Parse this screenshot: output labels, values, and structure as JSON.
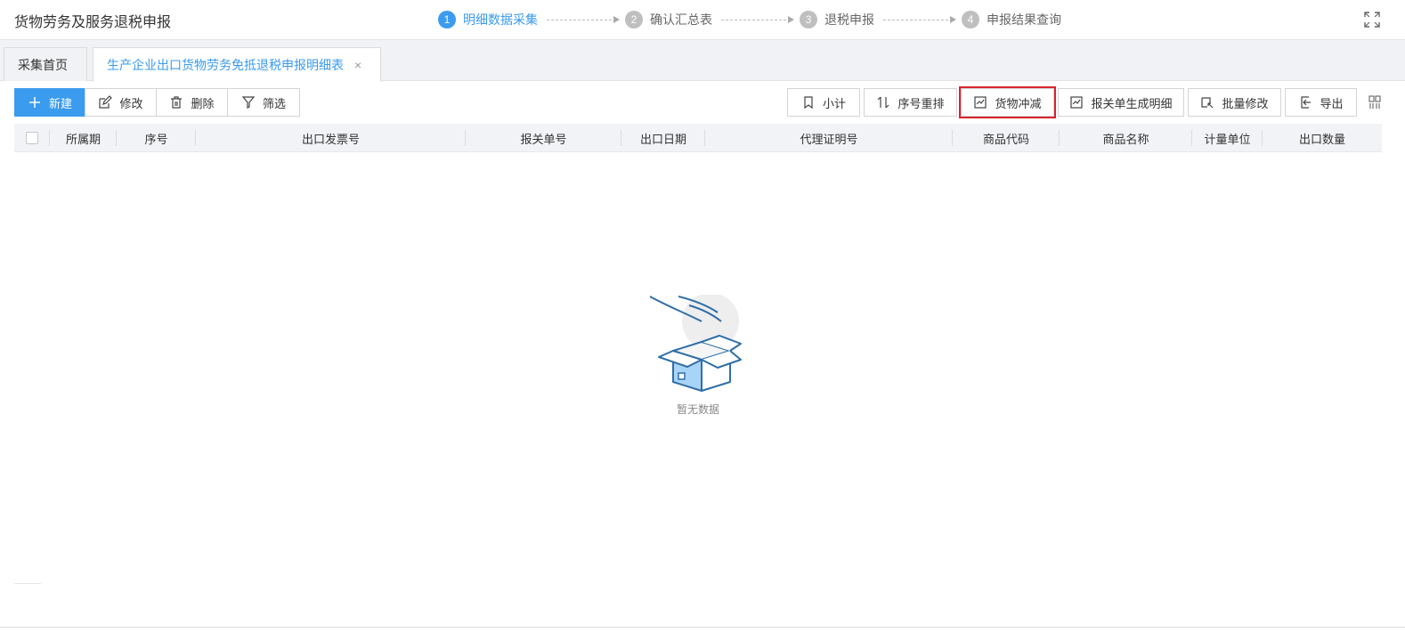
{
  "header": {
    "title": "货物劳务及服务退税申报",
    "steps": [
      {
        "num": "1",
        "label": "明细数据采集"
      },
      {
        "num": "2",
        "label": "确认汇总表"
      },
      {
        "num": "3",
        "label": "退税申报"
      },
      {
        "num": "4",
        "label": "申报结果查询"
      }
    ],
    "active_step": 1,
    "fullscreen_icon": "expand-icon"
  },
  "tabs": {
    "home": "采集首页",
    "active": "生产企业出口货物劳务免抵退税申报明细表",
    "close": "×"
  },
  "toolbar": {
    "left": [
      {
        "label": "新建",
        "icon": "plus-icon"
      },
      {
        "label": "修改",
        "icon": "edit-icon"
      },
      {
        "label": "删除",
        "icon": "trash-icon"
      },
      {
        "label": "筛选",
        "icon": "filter-icon"
      }
    ],
    "right": [
      {
        "label": "小计",
        "icon": "bookmark-icon"
      },
      {
        "label": "序号重排",
        "icon": "sort-icon"
      },
      {
        "label": "货物冲减",
        "icon": "chart-icon"
      },
      {
        "label": "报关单生成明细",
        "icon": "chart-icon"
      },
      {
        "label": "批量修改",
        "icon": "batch-edit-icon"
      },
      {
        "label": "导出",
        "icon": "export-icon"
      }
    ],
    "highlighted": "货物冲减",
    "primary_color": "#3a9bef",
    "highlight_color": "#d9232e"
  },
  "table": {
    "columns": [
      "所属期",
      "序号",
      "出口发票号",
      "报关单号",
      "出口日期",
      "代理证明号",
      "商品代码",
      "商品名称",
      "计量单位",
      "出口数量"
    ],
    "rows": [],
    "empty_text": "暂无数据"
  }
}
